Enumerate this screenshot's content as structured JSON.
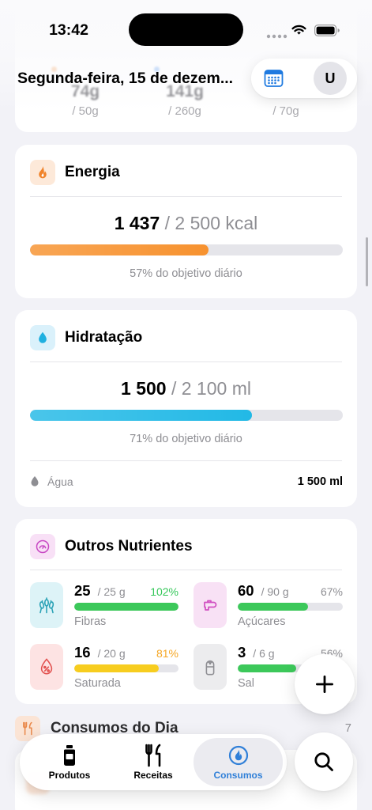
{
  "status_bar": {
    "time": "13:42"
  },
  "header": {
    "date": "Segunda-feira, 15 de dezem...",
    "avatar_initial": "U",
    "calendar_icon": "calendar-icon"
  },
  "macros_summary": {
    "items": [
      {
        "value": "74g",
        "goal": "/ 50g",
        "dot_color": "#f7a35c"
      },
      {
        "value": "141g",
        "goal": "/ 260g",
        "dot_color": "#5a9cf2"
      },
      {
        "goal": "/ 70g"
      }
    ]
  },
  "energy": {
    "title": "Energia",
    "icon": "flame-icon",
    "icon_bg": "#fde9d9",
    "icon_color": "#f0832a",
    "current": "1 437",
    "goal": " / 2 500 kcal",
    "progress": 0.57,
    "bar_color": "#f7922f",
    "caption": "57% do objetivo diário"
  },
  "hydration": {
    "title": "Hidratação",
    "icon": "water-drop-icon",
    "icon_bg": "#daf1fb",
    "icon_color": "#1fb0e0",
    "current": "1 500",
    "goal": " / 2 100 ml",
    "progress": 0.71,
    "bar_color": "#22b9e6",
    "caption": "71% do objetivo diário",
    "water_label": "Água",
    "water_value": "1 500 ml"
  },
  "other_nutrients": {
    "title": "Outros Nutrientes",
    "icon": "gauge-icon",
    "icon_bg": "#f8e0f6",
    "icon_color": "#c848c4",
    "items": [
      {
        "label": "Fibras",
        "value": "25",
        "goal": "/ 25 g",
        "percent": "102%",
        "progress": 1.02,
        "percent_color": "#34c759",
        "bar_color": "#3cc85a",
        "icon": "wheat-icon",
        "icon_bg": "#ddf3f7",
        "icon_color": "#2aa2b6"
      },
      {
        "label": "Açúcares",
        "value": "60",
        "goal": "/ 90 g",
        "percent": "67%",
        "progress": 0.67,
        "percent_color": "#8e8e93",
        "bar_color": "#3cc85a",
        "icon": "sugar-icon",
        "icon_bg": "#f8e1f5",
        "icon_color": "#d14fc1"
      },
      {
        "label": "Saturada",
        "value": "16",
        "goal": "/ 20 g",
        "percent": "81%",
        "progress": 0.81,
        "percent_color": "#f5a623",
        "bar_color": "#f7cd1f",
        "icon": "saturated-fat-icon",
        "icon_bg": "#fde3e3",
        "icon_color": "#e2514f"
      },
      {
        "label": "Sal",
        "value": "3",
        "goal": "/ 6 g",
        "percent": "56%",
        "progress": 0.56,
        "percent_color": "#8e8e93",
        "bar_color": "#3cc85a",
        "icon": "salt-shaker-icon",
        "icon_bg": "#ececee",
        "icon_color": "#8e8e93"
      }
    ]
  },
  "consumos": {
    "title": "Consumos do Dia",
    "count": "7",
    "icon": "fork-knife-icon",
    "icon_bg": "#fbe4d5",
    "icon_color": "#e9884a"
  },
  "tab_bar": {
    "tabs": [
      {
        "label": "Produtos",
        "icon": "bottle-icon",
        "active": false
      },
      {
        "label": "Receitas",
        "icon": "fork-knife-icon",
        "active": false
      },
      {
        "label": "Consumos",
        "icon": "flame-icon",
        "active": true
      }
    ],
    "search_icon": "search-icon"
  },
  "fab": {
    "icon": "plus-icon"
  },
  "colors": {
    "background": "#f2f2f7",
    "accent": "#2f7fd8",
    "good": "#34c759",
    "warning": "#f5a623",
    "muted_text": "#8e8e93"
  }
}
